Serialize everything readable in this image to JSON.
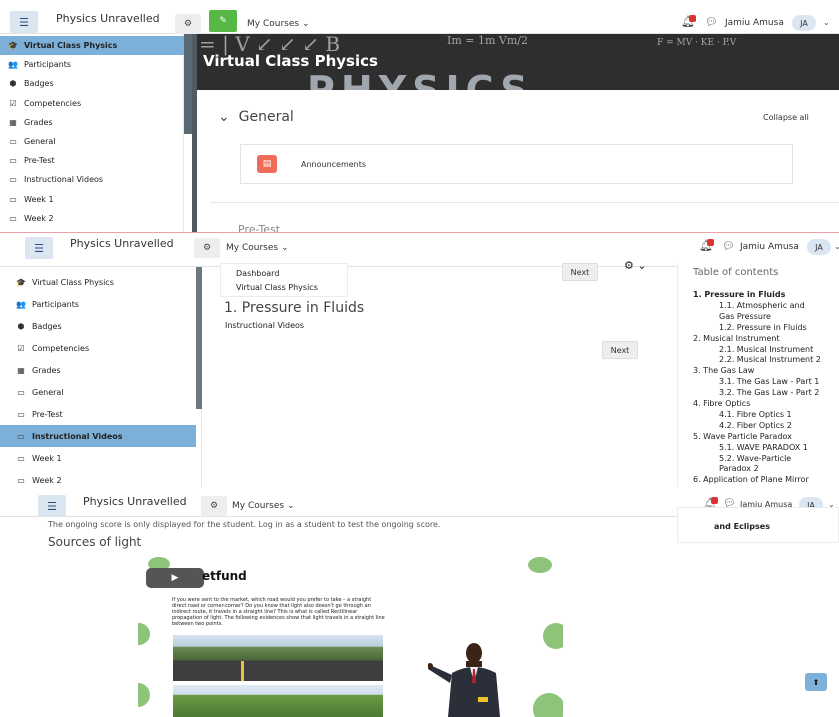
{
  "header": {
    "site_name": "Physics Unravelled",
    "menu_label": "My Courses",
    "user_name": "Jamiu Amusa",
    "user_initials": "JA"
  },
  "icons": {
    "menu": "hamburger-icon",
    "settings": "cog-icon",
    "edit": "pencil-icon",
    "notifications": "bell-icon",
    "messages": "speech-bubble-icon",
    "dropdown": "chevron-down-icon",
    "play": "play-icon",
    "back_to_top": "arrow-up-icon"
  },
  "colors": {
    "active_nav": "#7db0d8",
    "edit_toggle": "#57b846",
    "announcement_icon": "#ef6c57",
    "notification_badge": "#d33333"
  },
  "course": {
    "title": "Virtual Class Physics",
    "banner_word": "PHYSICS"
  },
  "sidebar_p1": [
    {
      "label": "Virtual Class Physics",
      "icon": "graduation-cap-icon",
      "glyph": "🎓",
      "active": true
    },
    {
      "label": "Participants",
      "icon": "users-icon",
      "glyph": "👥",
      "active": false
    },
    {
      "label": "Badges",
      "icon": "shield-icon",
      "glyph": "⬢",
      "active": false
    },
    {
      "label": "Competencies",
      "icon": "checkbox-icon",
      "glyph": "☑",
      "active": false
    },
    {
      "label": "Grades",
      "icon": "table-icon",
      "glyph": "▦",
      "active": false
    },
    {
      "label": "General",
      "icon": "folder-icon",
      "glyph": "▭",
      "active": false
    },
    {
      "label": "Pre-Test",
      "icon": "folder-icon",
      "glyph": "▭",
      "active": false
    },
    {
      "label": "Instructional Videos",
      "icon": "folder-icon",
      "glyph": "▭",
      "active": false
    },
    {
      "label": "Week 1",
      "icon": "folder-icon",
      "glyph": "▭",
      "active": false
    },
    {
      "label": "Week 2",
      "icon": "folder-icon",
      "glyph": "▭",
      "active": false
    }
  ],
  "sidebar_p2": [
    {
      "label": "Virtual Class Physics",
      "icon": "graduation-cap-icon",
      "glyph": "🎓",
      "active": false
    },
    {
      "label": "Participants",
      "icon": "users-icon",
      "glyph": "👥",
      "active": false
    },
    {
      "label": "Badges",
      "icon": "shield-icon",
      "glyph": "⬢",
      "active": false
    },
    {
      "label": "Competencies",
      "icon": "checkbox-icon",
      "glyph": "☑",
      "active": false
    },
    {
      "label": "Grades",
      "icon": "table-icon",
      "glyph": "▦",
      "active": false
    },
    {
      "label": "General",
      "icon": "folder-icon",
      "glyph": "▭",
      "active": false
    },
    {
      "label": "Pre-Test",
      "icon": "folder-icon",
      "glyph": "▭",
      "active": false
    },
    {
      "label": "Instructional Videos",
      "icon": "folder-icon",
      "glyph": "▭",
      "active": true
    },
    {
      "label": "Week 1",
      "icon": "folder-icon",
      "glyph": "▭",
      "active": false
    },
    {
      "label": "Week 2",
      "icon": "folder-icon",
      "glyph": "▭",
      "active": false
    }
  ],
  "general_section": {
    "title": "General",
    "collapse_all": "Collapse all",
    "activity": "Announcements",
    "next_section_peek": "Pre-Test"
  },
  "lesson": {
    "breadcrumbs": [
      "Dashboard",
      "Virtual Class Physics"
    ],
    "next_label": "Next",
    "title": "1. Pressure in Fluids",
    "section": "Instructional Videos"
  },
  "toc": {
    "title": "Table of contents",
    "items": [
      {
        "text": "1. Pressure in Fluids",
        "level": 0,
        "bold": true
      },
      {
        "text": "1.1. Atmospheric and",
        "level": 1,
        "bold": false
      },
      {
        "text": "Gas Pressure",
        "level": 1,
        "bold": false
      },
      {
        "text": "1.2. Pressure in Fluids",
        "level": 1,
        "bold": false
      },
      {
        "text": "2. Musical Instrument",
        "level": 0,
        "bold": false
      },
      {
        "text": "2.1. Musical Instrument",
        "level": 1,
        "bold": false
      },
      {
        "text": "2.2. Musical Instrument 2",
        "level": 1,
        "bold": false
      },
      {
        "text": "3. The Gas Law",
        "level": 0,
        "bold": false
      },
      {
        "text": "3.1. The Gas Law - Part 1",
        "level": 1,
        "bold": false
      },
      {
        "text": "3.2. The Gas Law - Part 2",
        "level": 1,
        "bold": false
      },
      {
        "text": "4. Fibre Optics",
        "level": 0,
        "bold": false
      },
      {
        "text": "4.1. Fibre Optics 1",
        "level": 1,
        "bold": false
      },
      {
        "text": "4.2. Fiber Optics 2",
        "level": 1,
        "bold": false
      },
      {
        "text": "5. Wave Particle Paradox",
        "level": 0,
        "bold": false
      },
      {
        "text": "5.1. WAVE PARADOX 1",
        "level": 1,
        "bold": false
      },
      {
        "text": "5.2. Wave-Particle",
        "level": 1,
        "bold": false
      },
      {
        "text": "Paradox 2",
        "level": 1,
        "bold": false
      },
      {
        "text": "6. Application of Plane Mirror",
        "level": 0,
        "bold": false
      }
    ],
    "tail_item": "and Eclipses"
  },
  "video_page": {
    "score_note": "The ongoing score is only displayed for the student. Log in as a student to test the ongoing score.",
    "heading": "Sources of light",
    "logo_text": "etfund",
    "slide_text": "If you were sent to the market, which road would you prefer to take – a straight direct road or corner-corner? Do you know that light also doesn't go through an indirect route, it travels in a straight line? This is what is called Rectilinear propagation of light. The following evidences show that light travels in a straight line between two points."
  }
}
